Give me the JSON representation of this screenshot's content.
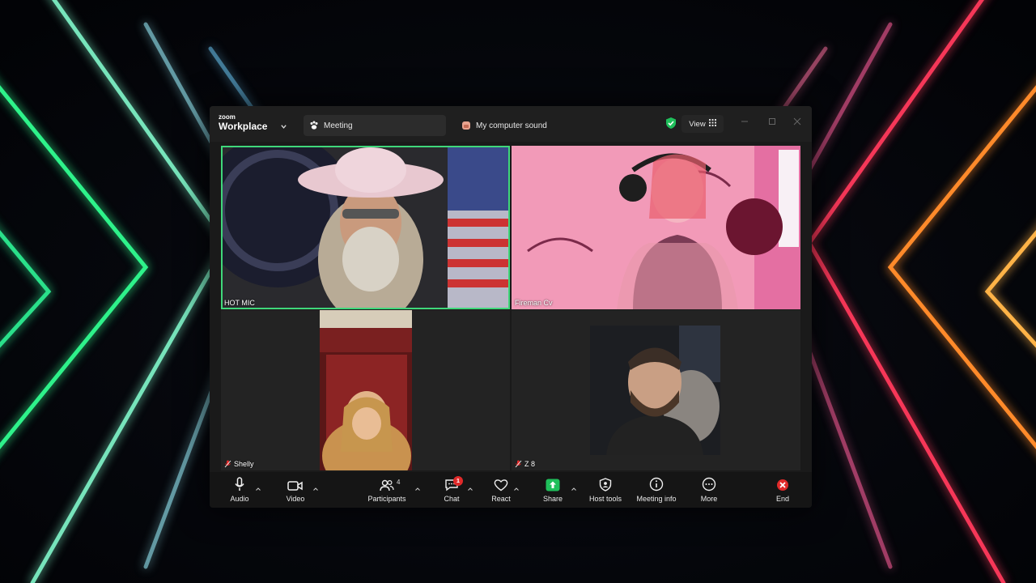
{
  "app": {
    "brand_small": "zoom",
    "brand_name": "Workplace"
  },
  "tabs": [
    {
      "label": "Meeting",
      "icon": "meeting-paw-icon",
      "active": true
    },
    {
      "label": "My computer sound",
      "icon": "computer-sound-icon",
      "active": false
    }
  ],
  "header": {
    "view_label": "View",
    "encryption_icon": "shield-check-icon"
  },
  "participants": [
    {
      "name": "HOT MIC",
      "muted": false,
      "active_speaker": true
    },
    {
      "name": "Fireman Cv",
      "muted": false,
      "active_speaker": false
    },
    {
      "name": "Shelly",
      "muted": true,
      "active_speaker": false
    },
    {
      "name": "Z 8",
      "muted": true,
      "active_speaker": false
    }
  ],
  "toolbar": {
    "audio": "Audio",
    "video": "Video",
    "participants": "Participants",
    "participant_count": "4",
    "chat": "Chat",
    "chat_badge": "1",
    "react": "React",
    "share": "Share",
    "host_tools": "Host tools",
    "meeting_info": "Meeting info",
    "more": "More",
    "end": "End"
  },
  "colors": {
    "speaker_border": "#3fd77a",
    "share_green": "#1fbf5b",
    "end_red": "#e02a2a",
    "badge_red": "#e02a2a"
  }
}
